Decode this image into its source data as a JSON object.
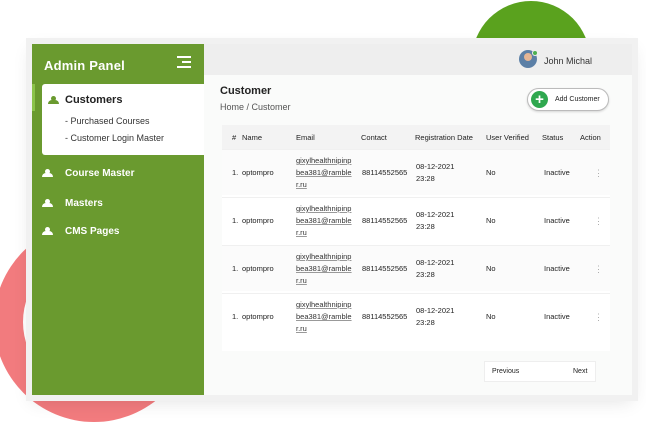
{
  "sidebar": {
    "brand": "Admin Panel",
    "active": {
      "label": "Customers",
      "sub_items": [
        "- Purchased Courses",
        "- Customer Login Master"
      ]
    },
    "items": [
      {
        "label": "Course Master"
      },
      {
        "label": "Masters"
      },
      {
        "label": "CMS Pages"
      }
    ]
  },
  "topbar": {
    "username": "John Michal"
  },
  "page": {
    "title": "Customer",
    "breadcrumb": "Home / Customer",
    "add_button": "Add Customer"
  },
  "table": {
    "columns": [
      "#",
      "Name",
      "Email",
      "Contact",
      "Registration Date",
      "User Verified",
      "Status",
      "Action"
    ],
    "rows": [
      {
        "num": "1.",
        "name": "optompro",
        "email": "gixylhealthnipinpbea381@rambler.ru",
        "contact": "88114552565",
        "date": "08-12-2021",
        "time": "23:28",
        "verified": "No",
        "status": "Inactive"
      },
      {
        "num": "1.",
        "name": "optompro",
        "email": "gixylhealthnipinpbea381@rambler.ru",
        "contact": "88114552565",
        "date": "08-12-2021",
        "time": "23:28",
        "verified": "No",
        "status": "Inactive"
      },
      {
        "num": "1.",
        "name": "optompro",
        "email": "gixylhealthnipinpbea381@rambler.ru",
        "contact": "88114552565",
        "date": "08-12-2021",
        "time": "23:28",
        "verified": "No",
        "status": "Inactive"
      },
      {
        "num": "1.",
        "name": "optompro",
        "email": "gixylhealthnipinpbea381@rambler.ru",
        "contact": "88114552565",
        "date": "08-12-2021",
        "time": "23:28",
        "verified": "No",
        "status": "Inactive"
      }
    ]
  },
  "pagination": {
    "previous": "Previous",
    "next": "Next"
  },
  "colors": {
    "sidebar": "#6a9a2f",
    "add_button_icon": "#2fa84f",
    "deco_green": "#5aa21e",
    "deco_red": "#f27b7e"
  },
  "icons": [
    "users-icon",
    "hamburger-icon",
    "plus-icon",
    "more-vertical-icon",
    "avatar"
  ]
}
